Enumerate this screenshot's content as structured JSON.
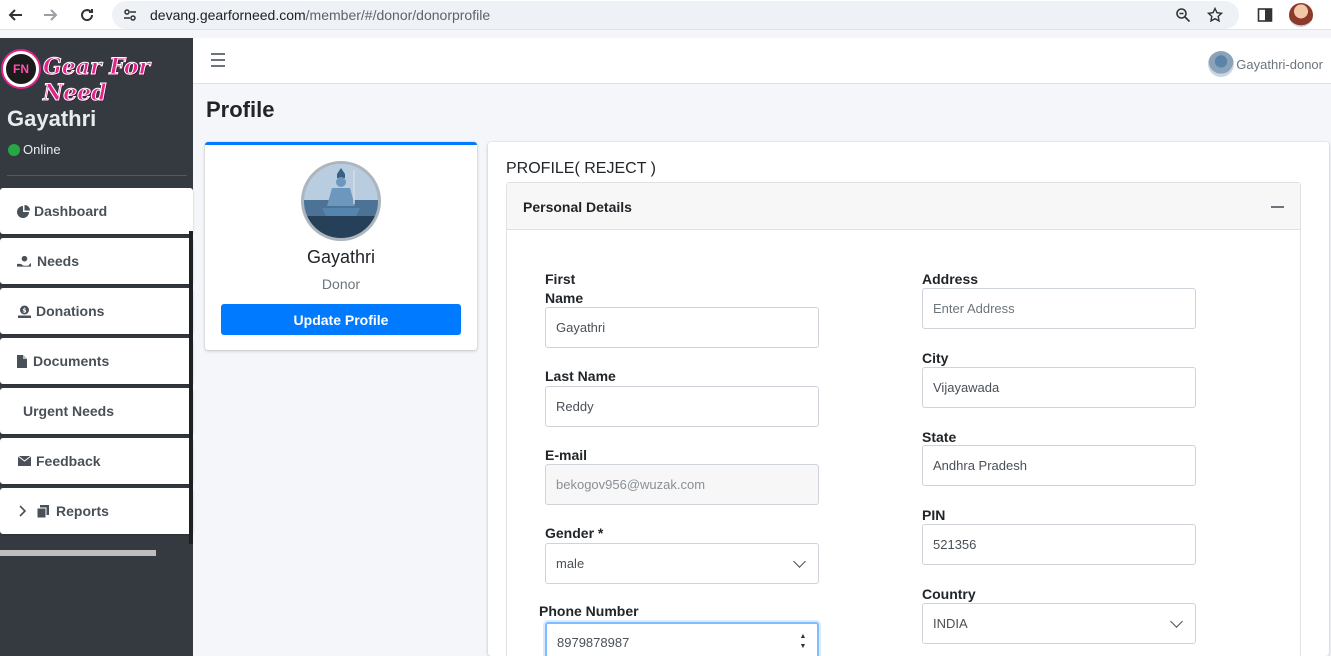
{
  "browser": {
    "url_host": "devang.gearforneed.com",
    "url_path": "/member/#/donor/donorprofile"
  },
  "brand": {
    "badge_text": "FN",
    "name": "Gear For Need"
  },
  "sidebar": {
    "user_name": "Gayathri",
    "status": "Online",
    "items": [
      {
        "label": "Dashboard",
        "icon": "pie-chart-icon"
      },
      {
        "label": "Needs",
        "icon": "hand-holding-icon"
      },
      {
        "label": "Donations",
        "icon": "donate-icon"
      },
      {
        "label": "Documents",
        "icon": "file-icon"
      },
      {
        "label": "Urgent Needs",
        "icon": ""
      },
      {
        "label": "Feedback",
        "icon": "envelope-icon"
      },
      {
        "label": "Reports",
        "icon": "copy-icon"
      }
    ]
  },
  "topbar": {
    "user_label": "Gayathri-donor"
  },
  "page": {
    "title": "Profile"
  },
  "profile_card": {
    "name": "Gayathri",
    "role": "Donor",
    "button_label": "Update Profile"
  },
  "main": {
    "title": "PROFILE( REJECT )",
    "panel_title": "Personal Details",
    "fields": {
      "first_name": {
        "label_line1": "First",
        "label_line2": "Name",
        "value": "Gayathri"
      },
      "last_name": {
        "label": "Last Name",
        "value": "Reddy"
      },
      "email": {
        "label": "E-mail",
        "value": "bekogov956@wuzak.com"
      },
      "gender": {
        "label": "Gender *",
        "value": "male"
      },
      "phone": {
        "label": "Phone Number",
        "value": "8979878987"
      },
      "address": {
        "label": "Address",
        "placeholder": "Enter Address"
      },
      "city": {
        "label": "City",
        "value": "Vijayawada"
      },
      "state": {
        "label": "State",
        "value": "Andhra Pradesh"
      },
      "pin": {
        "label": "PIN",
        "value": "521356"
      },
      "country": {
        "label": "Country",
        "value": "INDIA"
      }
    }
  },
  "colors": {
    "sidebar_bg": "#343a40",
    "primary": "#007bff",
    "online": "#28a745",
    "brand": "#e0248a"
  }
}
